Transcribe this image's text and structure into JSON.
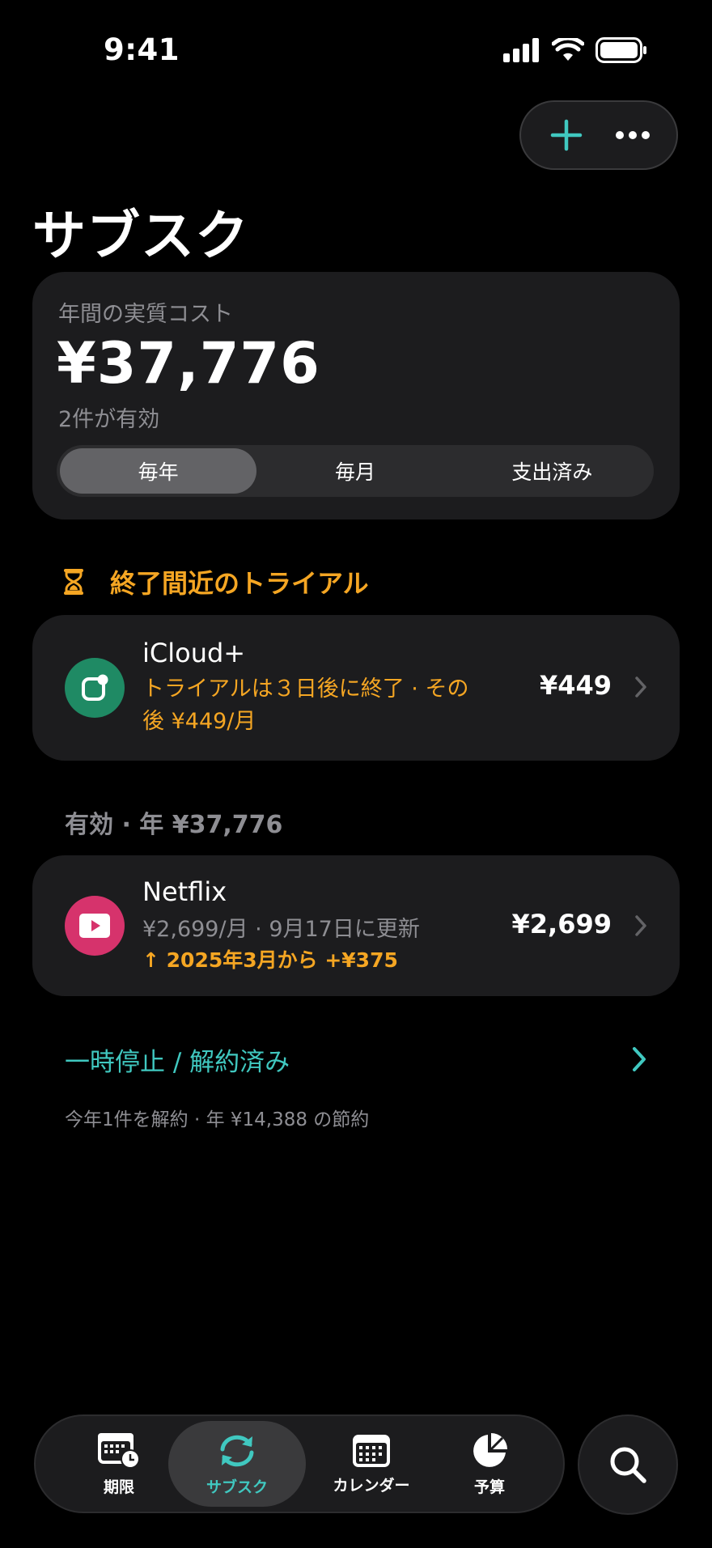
{
  "status_bar": {
    "time": "9:41"
  },
  "page": {
    "title": "サブスク"
  },
  "summary": {
    "label": "年間の実質コスト",
    "amount": "¥37,776",
    "active_count": "2件が有効",
    "segments": [
      "毎年",
      "毎月",
      "支出済み"
    ],
    "selected_segment": "毎年"
  },
  "trial_section": {
    "header": "終了間近のトライアル",
    "item": {
      "name": "iCloud+",
      "detail_line1": "トライアルは３日後に終了 · その",
      "detail_line2": "後 ¥449/月",
      "price": "¥449",
      "icon_color": "#1f8a64"
    }
  },
  "active_section": {
    "label": "有効 · 年 ¥37,776",
    "item": {
      "name": "Netflix",
      "detail": "¥2,699/月 · 9月17日に更新",
      "change": "↑ 2025年3月から +¥375",
      "price": "¥2,699",
      "icon_color": "#d6336c"
    }
  },
  "paused": {
    "label": "一時停止 / 解約済み",
    "note": "今年1件を解約 · 年 ¥14,388 の節約"
  },
  "tab_bar": {
    "tabs": [
      {
        "label": "期限",
        "icon": "calendar-clock-icon"
      },
      {
        "label": "サブスク",
        "icon": "sync-arrows-icon"
      },
      {
        "label": "カレンダー",
        "icon": "calendar-icon"
      },
      {
        "label": "予算",
        "icon": "pie-chart-icon"
      }
    ],
    "active_tab": "サブスク",
    "search_icon": "search-icon"
  },
  "colors": {
    "accent": "#40c8c0",
    "warning": "#f5a623",
    "card": "#1c1c1e",
    "secondary_text": "#8e8e93"
  }
}
